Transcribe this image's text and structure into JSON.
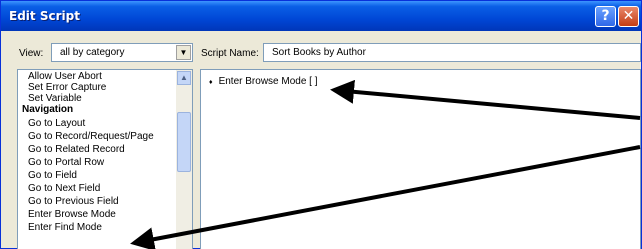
{
  "window": {
    "title": "Edit Script",
    "help_glyph": "?",
    "close_glyph": "✕"
  },
  "view": {
    "label": "View:",
    "selected": "all by category",
    "arrow_glyph": "▼"
  },
  "script_name": {
    "label": "Script Name:",
    "value": "Sort Books by Author"
  },
  "steps": [
    {
      "label": "Allow User Abort",
      "heading": false
    },
    {
      "label": "Set Error Capture",
      "heading": false
    },
    {
      "label": "Set Variable",
      "heading": false
    },
    {
      "label": "Navigation",
      "heading": true
    },
    {
      "label": "Go to Layout",
      "heading": false
    },
    {
      "label": "Go to Record/Request/Page",
      "heading": false
    },
    {
      "label": "Go to Related Record",
      "heading": false
    },
    {
      "label": "Go to Portal Row",
      "heading": false
    },
    {
      "label": "Go to Field",
      "heading": false
    },
    {
      "label": "Go to Next Field",
      "heading": false
    },
    {
      "label": "Go to Previous Field",
      "heading": false
    },
    {
      "label": "Enter Browse Mode",
      "heading": false
    },
    {
      "label": "Enter Find Mode",
      "heading": false
    }
  ],
  "scrollbar": {
    "up_glyph": "▲"
  },
  "editor": {
    "bullet_glyph": "♦",
    "lines": [
      "Enter Browse Mode [ ]"
    ]
  },
  "icons": [
    "help-icon",
    "close-icon",
    "chevron-down-icon",
    "scroll-up-icon",
    "bullet-icon"
  ]
}
